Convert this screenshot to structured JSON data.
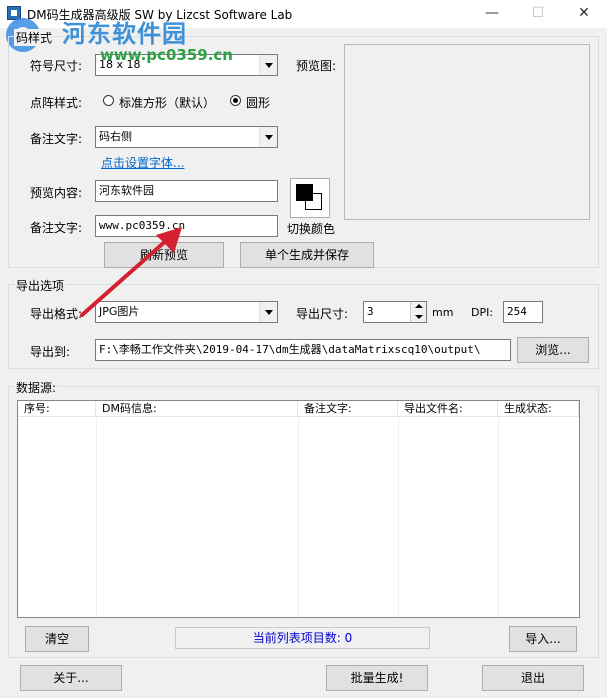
{
  "window": {
    "title": "DM码生成器高级版 SW  by Lizcst Software Lab",
    "minimize": "—",
    "maximize": "☐",
    "close": "✕"
  },
  "watermark": {
    "text": "河东软件园",
    "url": "www.pc0359.cn"
  },
  "code_style": {
    "group_title": "码样式",
    "symbol_size_label": "符号尺寸:",
    "symbol_size_value": "18 x 18",
    "dot_style_label": "点阵样式:",
    "dot_style_options": [
      "标准方形（默认）",
      "圆形"
    ],
    "dot_style_selected": "圆形",
    "note_text_label": "备注文字:",
    "note_text_value": "码右侧",
    "font_link": "点击设置字体...",
    "preview_content_label": "预览内容:",
    "preview_content_value": "河东软件园",
    "note_text2_label": "备注文字:",
    "note_text2_value": "www.pc0359.cn",
    "preview_label": "预览图:",
    "switch_color_label": "切换颜色",
    "refresh_button": "刷新预览",
    "save_single_button": "单个生成并保存"
  },
  "export": {
    "group_title": "导出选项",
    "format_label": "导出格式:",
    "format_value": "JPG图片",
    "size_label": "导出尺寸:",
    "size_value": "3",
    "size_unit": "mm",
    "dpi_label": "DPI:",
    "dpi_value": "254",
    "export_to_label": "导出到:",
    "export_path": "F:\\李畅工作文件夹\\2019-04-17\\dm生成器\\dataMatrixscq10\\output\\",
    "browse_button": "浏览..."
  },
  "data_source": {
    "group_title": "数据源:",
    "columns": [
      "序号:",
      "DM码信息:",
      "备注文字:",
      "导出文件名:",
      "生成状态:"
    ],
    "clear_button": "清空",
    "status_text": "当前列表项目数: 0",
    "import_button": "导入..."
  },
  "footer": {
    "about_button": "关于...",
    "batch_button": "批量生成!",
    "exit_button": "退出"
  },
  "colors": {
    "annotation_arrow": "#d3212f",
    "link": "#0066cc",
    "watermark": "#2f8ad6"
  }
}
